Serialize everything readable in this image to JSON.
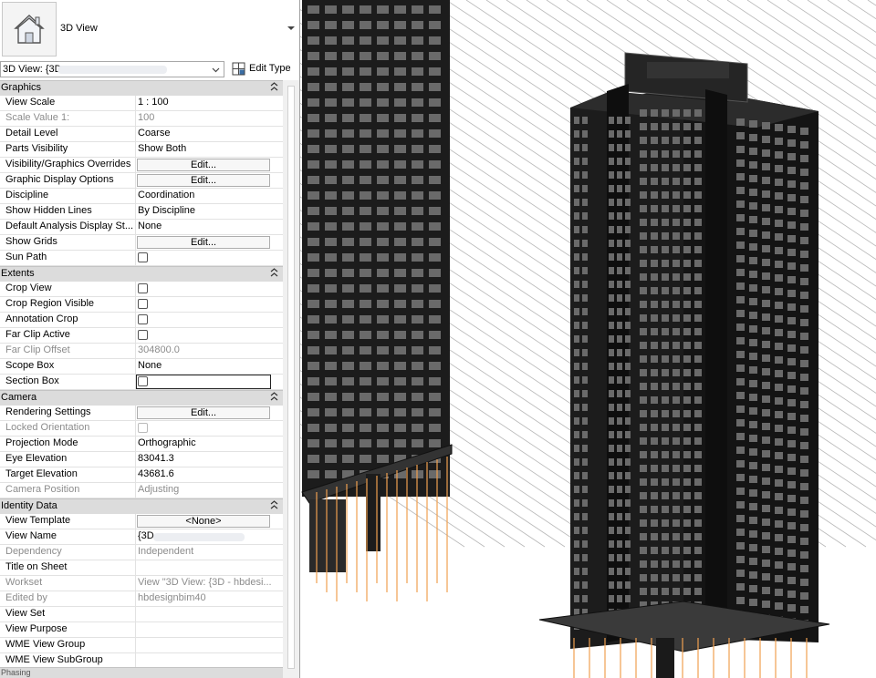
{
  "header": {
    "view_type": "3D View",
    "icon": "house-icon"
  },
  "selector": {
    "current_view": "3D View: {3D",
    "edit_type_label": "Edit Type"
  },
  "groups": [
    {
      "name": "Graphics",
      "rows": [
        {
          "name": "View Scale",
          "value": "1 : 100",
          "kind": "text"
        },
        {
          "name": "Scale Value    1:",
          "value": "100",
          "kind": "text",
          "dim": true
        },
        {
          "name": "Detail Level",
          "value": "Coarse",
          "kind": "text"
        },
        {
          "name": "Parts Visibility",
          "value": "Show Both",
          "kind": "text"
        },
        {
          "name": "Visibility/Graphics Overrides",
          "value": "Edit...",
          "kind": "button"
        },
        {
          "name": "Graphic Display Options",
          "value": "Edit...",
          "kind": "button"
        },
        {
          "name": "Discipline",
          "value": "Coordination",
          "kind": "text"
        },
        {
          "name": "Show Hidden Lines",
          "value": "By Discipline",
          "kind": "text"
        },
        {
          "name": "Default Analysis Display St...",
          "value": "None",
          "kind": "text"
        },
        {
          "name": "Show Grids",
          "value": "Edit...",
          "kind": "button"
        },
        {
          "name": "Sun Path",
          "value": "",
          "kind": "checkbox"
        }
      ]
    },
    {
      "name": "Extents",
      "rows": [
        {
          "name": "Crop View",
          "value": "",
          "kind": "checkbox"
        },
        {
          "name": "Crop Region Visible",
          "value": "",
          "kind": "checkbox"
        },
        {
          "name": "Annotation Crop",
          "value": "",
          "kind": "checkbox"
        },
        {
          "name": "Far Clip Active",
          "value": "",
          "kind": "checkbox"
        },
        {
          "name": "Far Clip Offset",
          "value": "304800.0",
          "kind": "text",
          "dim": true
        },
        {
          "name": "Scope Box",
          "value": "None",
          "kind": "text"
        },
        {
          "name": "Section Box",
          "value": "",
          "kind": "checkbox",
          "focus": true
        }
      ]
    },
    {
      "name": "Camera",
      "rows": [
        {
          "name": "Rendering Settings",
          "value": "Edit...",
          "kind": "button"
        },
        {
          "name": "Locked Orientation",
          "value": "",
          "kind": "checkbox",
          "dim": true
        },
        {
          "name": "Projection Mode",
          "value": "Orthographic",
          "kind": "text"
        },
        {
          "name": "Eye Elevation",
          "value": "83041.3",
          "kind": "text"
        },
        {
          "name": "Target Elevation",
          "value": "43681.6",
          "kind": "text"
        },
        {
          "name": "Camera Position",
          "value": "Adjusting",
          "kind": "text",
          "dim": true
        }
      ]
    },
    {
      "name": "Identity Data",
      "rows": [
        {
          "name": "View Template",
          "value": "<None>",
          "kind": "button"
        },
        {
          "name": "View Name",
          "value": "{3D",
          "kind": "text",
          "blur": true
        },
        {
          "name": "Dependency",
          "value": "Independent",
          "kind": "text",
          "dim": true
        },
        {
          "name": "Title on Sheet",
          "value": "",
          "kind": "text"
        },
        {
          "name": "Workset",
          "value": "View \"3D View: {3D - hbdesi...",
          "kind": "text",
          "dim": true
        },
        {
          "name": "Edited by",
          "value": "hbdesignbim40",
          "kind": "text",
          "dim": true
        },
        {
          "name": "View Set",
          "value": "",
          "kind": "text"
        },
        {
          "name": "View Purpose",
          "value": "",
          "kind": "text"
        },
        {
          "name": "WME View Group",
          "value": "",
          "kind": "text"
        },
        {
          "name": "WME View SubGroup",
          "value": "",
          "kind": "text"
        }
      ]
    }
  ],
  "colors": {
    "group_header": "#dcdcdc",
    "building_fill": "#1c1c1c",
    "building_window": "#6a6a6a",
    "pile_color": "#f0a050",
    "grid_line": "#b8b8b8"
  }
}
